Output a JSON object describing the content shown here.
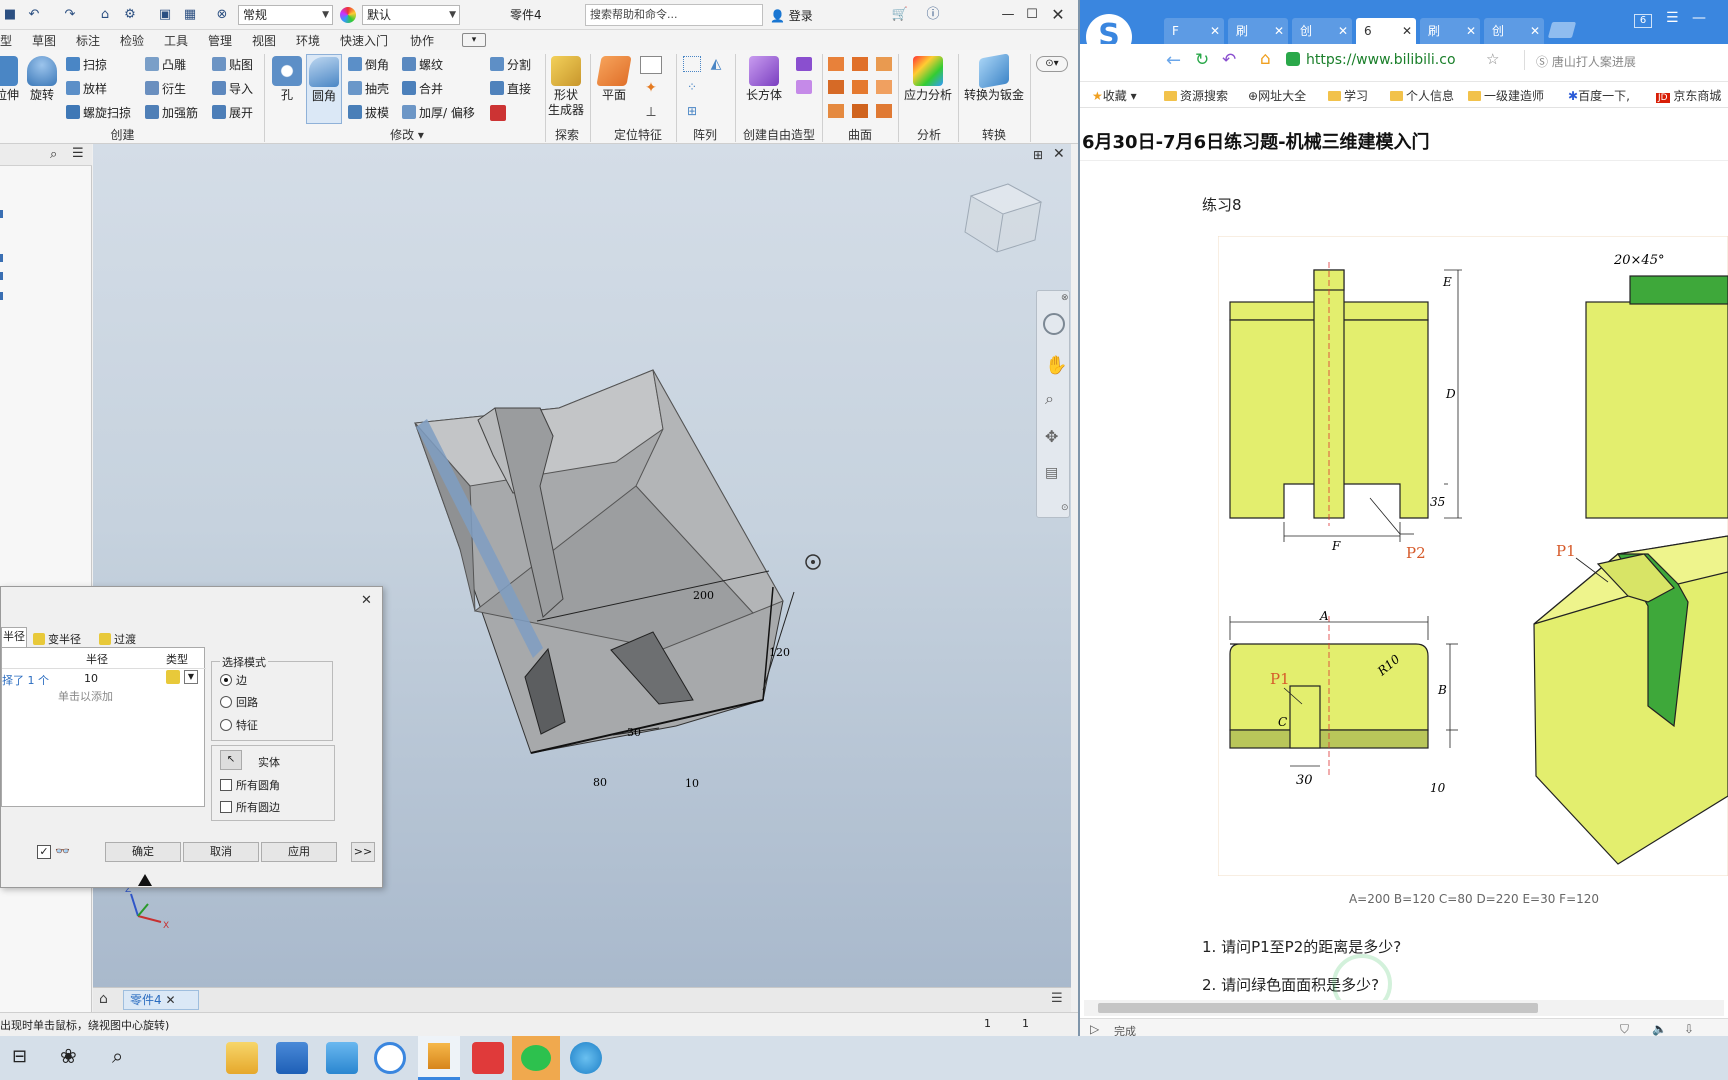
{
  "inventor": {
    "qat": {
      "style_combo": "常规",
      "appearance_combo": "默认",
      "doc_title": "零件4",
      "search_placeholder": "搜索帮助和命令...",
      "login": "登录"
    },
    "menu": [
      "型",
      "草图",
      "标注",
      "检验",
      "工具",
      "管理",
      "视图",
      "环境",
      "快速入门",
      "协作"
    ],
    "ribbon": {
      "create": {
        "extrude": "拉伸",
        "revolve": "旋转",
        "sweep": "扫掠",
        "loft": "放样",
        "coil": "螺旋扫掠",
        "emboss": "凸雕",
        "derive": "衍生",
        "rib": "加强筋",
        "decal": "贴图",
        "import": "导入",
        "unfold": "展开",
        "group": "创建"
      },
      "modify": {
        "hole": "孔",
        "fillet": "圆角",
        "chamfer": "倒角",
        "shell": "抽壳",
        "draft": "拔模",
        "thread": "螺纹",
        "combine": "合并",
        "thicken": "加厚/ 偏移",
        "split": "分割",
        "direct": "直接",
        "group": "修改"
      },
      "explore": {
        "shape": "形状",
        "generator": "生成器",
        "group": "探索"
      },
      "work": {
        "plane": "平面",
        "group": "定位特征"
      },
      "pattern": {
        "group": "阵列"
      },
      "freeform": {
        "box": "长方体",
        "group": "创建自由造型"
      },
      "surface": {
        "group": "曲面"
      },
      "analysis": {
        "stress": "应力分析",
        "group": "分析"
      },
      "convert": {
        "sheet": "转换为钣金",
        "group": "转换"
      }
    },
    "dialog": {
      "tabs": [
        "半径",
        "变半径",
        "过渡"
      ],
      "col_radius": "半径",
      "col_type": "类型",
      "row_selected": "择了 1 个",
      "row_value": "10",
      "row_add": "单击以添加",
      "mode_group": "选择模式",
      "modes": [
        "边",
        "回路",
        "特征"
      ],
      "solid": "实体",
      "all_fillets": "所有圆角",
      "all_rounds": "所有圆边",
      "ok": "确定",
      "cancel": "取消",
      "apply": "应用",
      "more": ">>"
    },
    "dims": {
      "d200": "200",
      "d120": "120",
      "d30": "30",
      "d80": "80",
      "d10": "10"
    },
    "view_tab": "零件4",
    "status_text": "出现时单击鼠标，绕视图中心旋转)",
    "status_n1": "1",
    "status_n2": "1"
  },
  "browser": {
    "tabs": [
      "F",
      "刷",
      "创",
      "6",
      "刷",
      "创"
    ],
    "tab_count": "6",
    "url": "https://www.bilibili.co",
    "search_hint": "唐山打人案进展",
    "bookmarks": [
      "收藏",
      "资源搜索",
      "网址大全",
      "学习",
      "个人信息",
      "一级建造师",
      "百度一下,",
      "京东商城"
    ],
    "page_title": "6月30日-7月6日练习题-机械三维建模入门",
    "exercise": "练习8",
    "drawing": {
      "chamfer": "20×45°",
      "labels": [
        "E",
        "D",
        "35",
        "F",
        "P2",
        "P1",
        "A",
        "R10",
        "B",
        "C",
        "30",
        "10",
        "P1"
      ]
    },
    "params": "A=200  B=120 C=80 D=220 E=30 F=120",
    "questions": [
      "1. 请问P1至P2的距离是多少?",
      "2. 请问绿色面面积是多少?"
    ],
    "status": "完成"
  },
  "colors": {
    "accent": "#3a86df",
    "model_gray": "#a7a9ab",
    "drawing_yellow": "#e3ee6e",
    "drawing_green": "#3ea83a"
  }
}
